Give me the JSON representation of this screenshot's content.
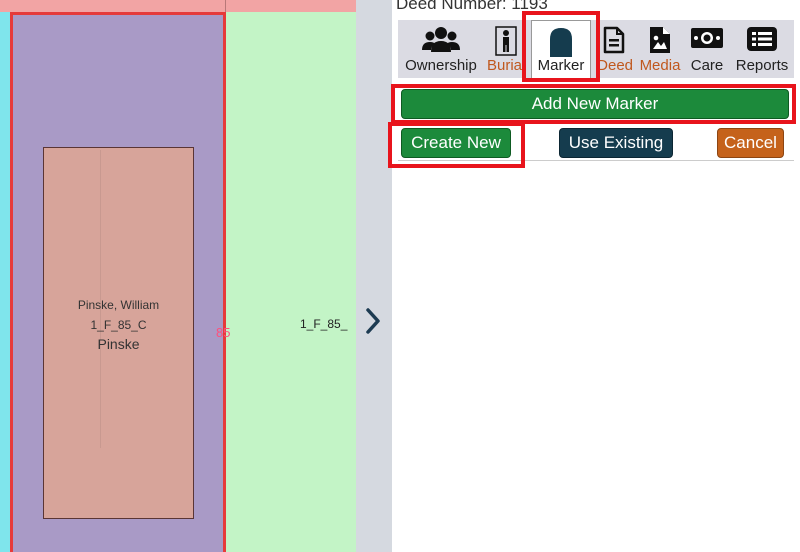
{
  "deed": {
    "label": "Deed Number: 1193"
  },
  "tabs": [
    {
      "label": "Ownership",
      "icon": "users-icon"
    },
    {
      "label": "Burial",
      "icon": "person-icon"
    },
    {
      "label": "Marker",
      "icon": "headstone-icon"
    },
    {
      "label": "Deed",
      "icon": "document-icon"
    },
    {
      "label": "Media",
      "icon": "image-file-icon"
    },
    {
      "label": "Care",
      "icon": "money-icon"
    },
    {
      "label": "Reports",
      "icon": "list-icon"
    }
  ],
  "actions": {
    "add_new_marker": "Add New Marker",
    "create_new": "Create New",
    "use_existing": "Use Existing",
    "cancel": "Cancel"
  },
  "map": {
    "grave_owner": "Pinske, William",
    "grave_id": "1_F_85_C",
    "grave_marker": "Pinske",
    "plot_number": "85",
    "neighbor_label": "1_F_85_"
  },
  "colors": {
    "green": "#1c8a3b",
    "navy": "#153c4e",
    "orange": "#c5621b",
    "highlight": "#e8141c"
  }
}
